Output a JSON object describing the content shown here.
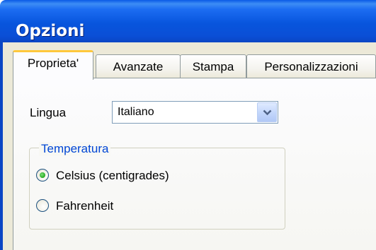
{
  "window": {
    "title": "Opzioni"
  },
  "tabs": [
    {
      "label": "Proprieta'",
      "active": true
    },
    {
      "label": "Avanzate",
      "active": false
    },
    {
      "label": "Stampa",
      "active": false
    },
    {
      "label": "Personalizzazioni",
      "active": false
    }
  ],
  "language": {
    "label": "Lingua",
    "selected": "Italiano",
    "dropdown_icon": "chevron-down-icon"
  },
  "temperature": {
    "group_title": "Temperatura",
    "options": [
      {
        "label": "Celsius (centigrades)",
        "checked": true
      },
      {
        "label": "Fahrenheit",
        "checked": false
      }
    ]
  },
  "colors": {
    "titlebar": "#0a4fd6",
    "active_tab_accent": "#ffc83c",
    "group_title": "#0046d5",
    "radio_dot": "#30b02a"
  }
}
